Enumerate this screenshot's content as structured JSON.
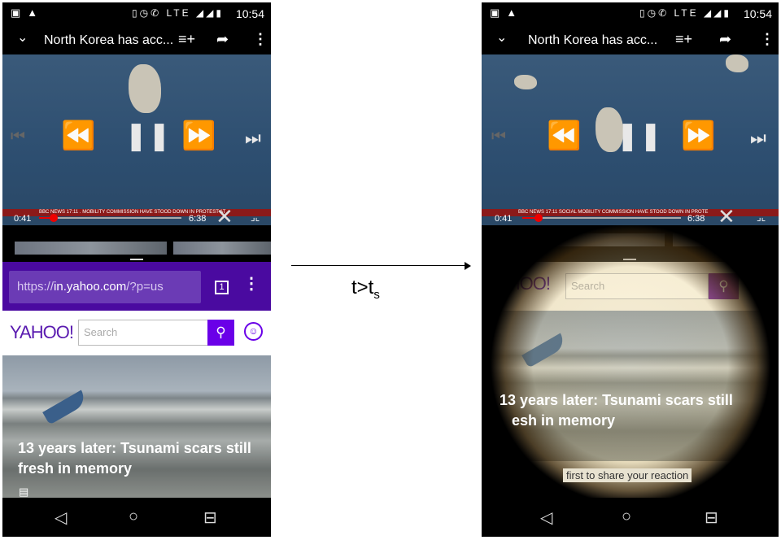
{
  "status": {
    "time": "10:54",
    "icons": [
      "image-icon",
      "warning-icon",
      "vibrate-icon",
      "alarm-icon",
      "4g-icon",
      "lte-icon",
      "signal-icon",
      "signal-icon",
      "battery-icon"
    ],
    "network": "LTE"
  },
  "player": {
    "title": "North Korea has acc...",
    "elapsed": "0:41",
    "duration": "6:38",
    "progress": 0.107,
    "ticker_left": "NEWS  17:11  . MOBILITY COMMISSION HAVE STOOD DOWN IN PROTEST AT",
    "ticker_right": "NEWS  17:11  SOCIAL MOBILITY COMMISSION HAVE STOOD DOWN IN PROTE",
    "ticker_brand": "BBC"
  },
  "browser": {
    "url_prefix": "https://",
    "url_host": "in.yahoo.com",
    "url_suffix": "/?p=us",
    "tab_count": "1"
  },
  "yahoo": {
    "logo": "YAHOO!",
    "logo_partial": "OO!",
    "search_placeholder": "Search",
    "headline_line1": "13 years later: Tsunami scars still",
    "headline_line2": "fresh in memory",
    "headline_partial1": "13 years later: Tsunami scars still",
    "headline_partial2": "esh in memory",
    "reaction": "first to share your reaction"
  },
  "figure": {
    "arrow_label": "t>t",
    "arrow_label_sub": "s"
  },
  "colors": {
    "yahoo_purple": "#6a00e8",
    "urlbar": "#4a0aa0",
    "progress": "#ee0000"
  }
}
